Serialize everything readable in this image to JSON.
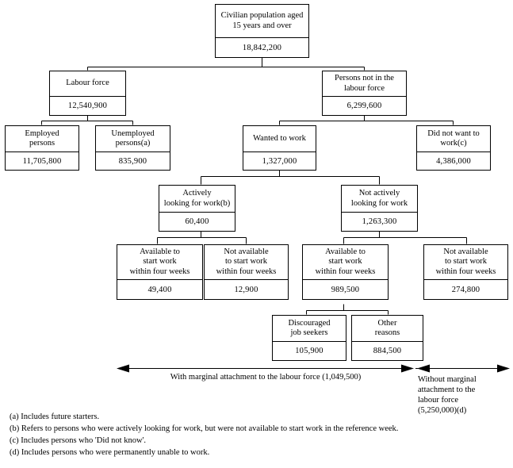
{
  "chart_data": {
    "type": "diagram",
    "title": "Civilian population aged 15 years and over — labour force framework",
    "nodes": [
      {
        "id": "pop",
        "label_lines": [
          "Civilian population aged",
          "15 years and over"
        ],
        "value": "18,842,200"
      },
      {
        "id": "lf",
        "label_lines": [
          "Labour force"
        ],
        "value": "12,540,900"
      },
      {
        "id": "nilf",
        "label_lines": [
          "Persons not in the",
          "labour force"
        ],
        "value": "6,299,600"
      },
      {
        "id": "emp",
        "label_lines": [
          "Employed",
          "persons"
        ],
        "value": "11,705,800"
      },
      {
        "id": "unemp",
        "label_lines": [
          "Unemployed",
          "persons(a)"
        ],
        "value": "835,900"
      },
      {
        "id": "wanted",
        "label_lines": [
          "Wanted to work"
        ],
        "value": "1,327,000"
      },
      {
        "id": "notwanted",
        "label_lines": [
          "Did not want to",
          "work(c)"
        ],
        "value": "4,386,000"
      },
      {
        "id": "actively",
        "label_lines": [
          "Actively",
          "looking for work(b)"
        ],
        "value": "60,400"
      },
      {
        "id": "notactive",
        "label_lines": [
          "Not actively",
          "looking for work"
        ],
        "value": "1,263,300"
      },
      {
        "id": "avail1",
        "label_lines": [
          "Available to",
          "start work",
          "within four weeks"
        ],
        "value": "49,400"
      },
      {
        "id": "notavail1",
        "label_lines": [
          "Not available",
          "to start work",
          "within four weeks"
        ],
        "value": "12,900"
      },
      {
        "id": "avail2",
        "label_lines": [
          "Available to",
          "start work",
          "within four weeks"
        ],
        "value": "989,500"
      },
      {
        "id": "notavail2",
        "label_lines": [
          "Not available",
          "to start work",
          "within four weeks"
        ],
        "value": "274,800"
      },
      {
        "id": "discouraged",
        "label_lines": [
          "Discouraged",
          "job seekers"
        ],
        "value": "105,900"
      },
      {
        "id": "other",
        "label_lines": [
          "Other",
          "reasons"
        ],
        "value": "884,500"
      }
    ],
    "edges": [
      {
        "from": "pop",
        "to": "lf"
      },
      {
        "from": "pop",
        "to": "nilf"
      },
      {
        "from": "lf",
        "to": "emp"
      },
      {
        "from": "lf",
        "to": "unemp"
      },
      {
        "from": "nilf",
        "to": "wanted"
      },
      {
        "from": "nilf",
        "to": "notwanted"
      },
      {
        "from": "wanted",
        "to": "actively"
      },
      {
        "from": "wanted",
        "to": "notactive"
      },
      {
        "from": "actively",
        "to": "avail1"
      },
      {
        "from": "actively",
        "to": "notavail1"
      },
      {
        "from": "notactive",
        "to": "avail2"
      },
      {
        "from": "notactive",
        "to": "notavail2"
      },
      {
        "from": "avail2",
        "to": "discouraged"
      },
      {
        "from": "avail2",
        "to": "other"
      }
    ],
    "annotations": [
      {
        "id": "with-marginal",
        "text": "With marginal attachment to the labour force (1,049,500)"
      },
      {
        "id": "without-marginal",
        "lines": [
          "Without marginal",
          "attachment to the",
          "labour force",
          "(5,250,000)(d)"
        ]
      }
    ]
  },
  "boxes": {
    "pop": {
      "label1": "Civilian population aged",
      "label2": "15 years and over",
      "value": "18,842,200"
    },
    "lf": {
      "label1": "Labour force",
      "value": "12,540,900"
    },
    "nilf": {
      "label1": "Persons not in the",
      "label2": "labour force",
      "value": "6,299,600"
    },
    "emp": {
      "label1": "Employed",
      "label2": "persons",
      "value": "11,705,800"
    },
    "unemp": {
      "label1": "Unemployed",
      "label2": "persons(a)",
      "value": "835,900"
    },
    "wanted": {
      "label1": "Wanted to work",
      "value": "1,327,000"
    },
    "notwanted": {
      "label1": "Did not want to",
      "label2": "work(c)",
      "value": "4,386,000"
    },
    "actively": {
      "label1": "Actively",
      "label2": "looking for work(b)",
      "value": "60,400"
    },
    "notactive": {
      "label1": "Not actively",
      "label2": "looking for work",
      "value": "1,263,300"
    },
    "avail1": {
      "label1": "Available to",
      "label2": "start work",
      "label3": "within four weeks",
      "value": "49,400"
    },
    "notavail1": {
      "label1": "Not available",
      "label2": "to start work",
      "label3": "within four weeks",
      "value": "12,900"
    },
    "avail2": {
      "label1": "Available to",
      "label2": "start work",
      "label3": "within four weeks",
      "value": "989,500"
    },
    "notavail2": {
      "label1": "Not available",
      "label2": "to start work",
      "label3": "within four weeks",
      "value": "274,800"
    },
    "discouraged": {
      "label1": "Discouraged",
      "label2": "job seekers",
      "value": "105,900"
    },
    "other": {
      "label1": "Other",
      "label2": "reasons",
      "value": "884,500"
    }
  },
  "annotations": {
    "with_marginal": "With marginal attachment to the labour force (1,049,500)",
    "without_marginal_l1": "Without marginal",
    "without_marginal_l2": "attachment to the",
    "without_marginal_l3": "labour force",
    "without_marginal_l4": "(5,250,000)(d)"
  },
  "footnotes": {
    "a": "(a) Includes future starters.",
    "b": "(b) Refers to persons who were actively looking for work, but were not available to start work in the reference week.",
    "c": "(c) Includes persons who 'Did not know'.",
    "d": "(d) Includes persons who were permanently unable to work."
  },
  "colors": {
    "line": "#000000",
    "background": "#ffffff",
    "text": "#000000"
  }
}
